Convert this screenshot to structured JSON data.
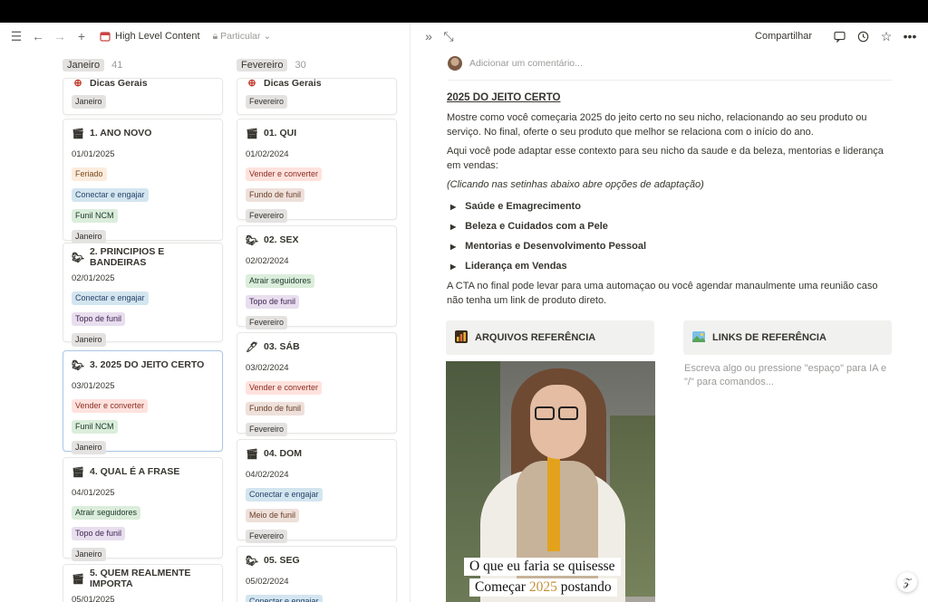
{
  "header": {
    "title": "High Level Content",
    "privacy": "Particular"
  },
  "right_header": {
    "share": "Compartilhar"
  },
  "columns": [
    {
      "name": "Janeiro",
      "count": "41",
      "cut_card": {
        "title": "Dicas Gerais",
        "tags": [
          {
            "label": "Janeiro",
            "color": "gray"
          }
        ]
      },
      "cards": [
        {
          "title": "1. ANO NOVO",
          "date": "01/01/2025",
          "icon": "clapper-icon",
          "tags": [
            {
              "label": "Feriado",
              "color": "orange"
            },
            {
              "label": "Conectar e engajar",
              "color": "blue"
            },
            {
              "label": "Funil NCM",
              "color": "green"
            },
            {
              "label": "Janeiro",
              "color": "gray"
            }
          ]
        },
        {
          "title": "2. PRINCIPIOS E BANDEIRAS",
          "date": "02/01/2025",
          "icon": "horse-icon",
          "tags": [
            {
              "label": "Conectar e engajar",
              "color": "blue"
            },
            {
              "label": "Topo de funil",
              "color": "purple"
            },
            {
              "label": "Janeiro",
              "color": "gray"
            }
          ]
        },
        {
          "title": "3. 2025 DO JEITO CERTO",
          "date": "03/01/2025",
          "icon": "horse-icon",
          "selected": true,
          "tags": [
            {
              "label": "Vender e converter",
              "color": "red"
            },
            {
              "label": "Funil NCM",
              "color": "green"
            },
            {
              "label": "Janeiro",
              "color": "gray"
            }
          ]
        },
        {
          "title": "4. QUAL É A FRASE",
          "date": "04/01/2025",
          "icon": "clapper-icon",
          "tags": [
            {
              "label": "Atrair seguidores",
              "color": "green"
            },
            {
              "label": "Topo de funil",
              "color": "purple"
            },
            {
              "label": "Janeiro",
              "color": "gray"
            }
          ]
        },
        {
          "title": "5. QUEM REALMENTE IMPORTA",
          "date": "05/01/2025",
          "icon": "clapper-icon",
          "tags": []
        }
      ]
    },
    {
      "name": "Fevereiro",
      "count": "30",
      "cut_card": {
        "title": "Dicas Gerais",
        "tags": [
          {
            "label": "Fevereiro",
            "color": "gray"
          }
        ]
      },
      "cards": [
        {
          "title": "01. QUI",
          "date": "01/02/2024",
          "icon": "clapper-icon",
          "tags": [
            {
              "label": "Vender e converter",
              "color": "red"
            },
            {
              "label": "Fundo de funil",
              "color": "brown"
            },
            {
              "label": "Fevereiro",
              "color": "gray"
            }
          ]
        },
        {
          "title": "02. SEX",
          "date": "02/02/2024",
          "icon": "horse-icon",
          "tags": [
            {
              "label": "Atrair seguidores",
              "color": "green"
            },
            {
              "label": "Topo de funil",
              "color": "purple"
            },
            {
              "label": "Fevereiro",
              "color": "gray"
            }
          ]
        },
        {
          "title": "03. SÁB",
          "date": "03/02/2024",
          "icon": "pen-icon",
          "tags": [
            {
              "label": "Vender e converter",
              "color": "red"
            },
            {
              "label": "Fundo de funil",
              "color": "brown"
            },
            {
              "label": "Fevereiro",
              "color": "gray"
            }
          ]
        },
        {
          "title": "04. DOM",
          "date": "04/02/2024",
          "icon": "clapper-icon",
          "tags": [
            {
              "label": "Conectar e engajar",
              "color": "blue"
            },
            {
              "label": "Meio de funil",
              "color": "brown"
            },
            {
              "label": "Fevereiro",
              "color": "gray"
            }
          ]
        },
        {
          "title": "05. SEG",
          "date": "05/02/2024",
          "icon": "horse-icon",
          "tags": [
            {
              "label": "Conectar e engajar",
              "color": "blue"
            }
          ]
        }
      ]
    }
  ],
  "page": {
    "comment_placeholder": "Adicionar um comentário...",
    "heading": "2025 DO JEITO CERTO",
    "p1": "Mostre como você começaria 2025 do jeito certo no seu nicho, relacionando ao seu produto ou serviço. No final, oferte o seu produto que melhor se relaciona com o início do ano.",
    "p2": "Aqui você pode adaptar esse contexto para seu nicho da saude e da beleza, mentorias e liderança em vendas:",
    "p3": "(Clicando nas setinhas abaixo abre opções de adaptação)",
    "toggles": [
      "Saúde e Emagrecimento",
      "Beleza e Cuidados com a Pele",
      "Mentorias e Desenvolvimento Pessoal",
      "Liderança em Vendas"
    ],
    "p4": "A CTA no final pode levar para uma automaçao ou você agendar manaulmente uma reunião caso não tenha um link de produto direto.",
    "ref_files": "ARQUIVOS REFERÊNCIA",
    "ref_links": "LINKS DE REFERÊNCIA",
    "placeholder": "Escreva algo ou pressione \"espaço\" para IA e \"/\" para comandos...",
    "photo_caption_1": "O que eu faria se quisesse",
    "photo_caption_2a": "Começar ",
    "photo_caption_2b": "2025",
    "photo_caption_2c": " postando"
  }
}
